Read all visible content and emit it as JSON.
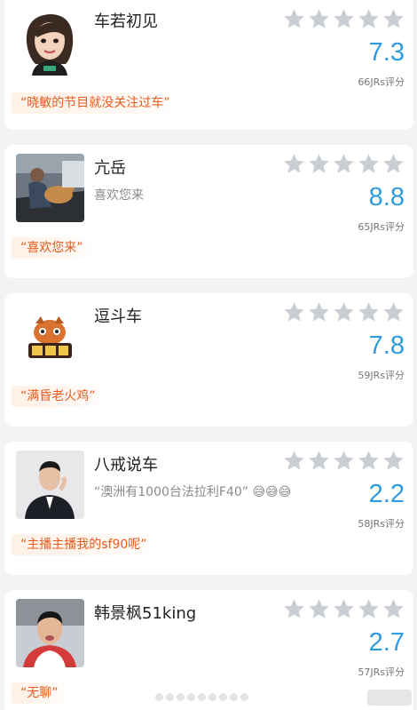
{
  "entries": [
    {
      "name": "车若初见",
      "subtitle": "",
      "score": "7.3",
      "ratings": "66JRs评分",
      "comment": "“晓敏的节目就没关注过车”",
      "stars_filled": 0
    },
    {
      "name": "亢岳",
      "subtitle": "喜欢您来",
      "score": "8.8",
      "ratings": "65JRs评分",
      "comment": "“喜欢您来”",
      "stars_filled": 0
    },
    {
      "name": "逗斗车",
      "subtitle": "",
      "score": "7.8",
      "ratings": "59JRs评分",
      "comment": "“满昏老火鸡”",
      "stars_filled": 0
    },
    {
      "name": "八戒说车",
      "subtitle": "“澳洲有1000台法拉利F40” 😅😅😅",
      "score": "2.2",
      "ratings": "58JRs评分",
      "comment": "“主播主播我的sf90呢”",
      "stars_filled": 0
    },
    {
      "name": "韩景枫51king",
      "subtitle": "",
      "score": "2.7",
      "ratings": "57JRs评分",
      "comment": "“无聊”",
      "stars_filled": 0
    }
  ],
  "colors": {
    "score": "#2e9bdc",
    "comment_text": "#e85a1e",
    "comment_bg": "#fff1e6",
    "star_empty": "#c9cdd4"
  },
  "icons": {
    "star": "star-icon"
  }
}
